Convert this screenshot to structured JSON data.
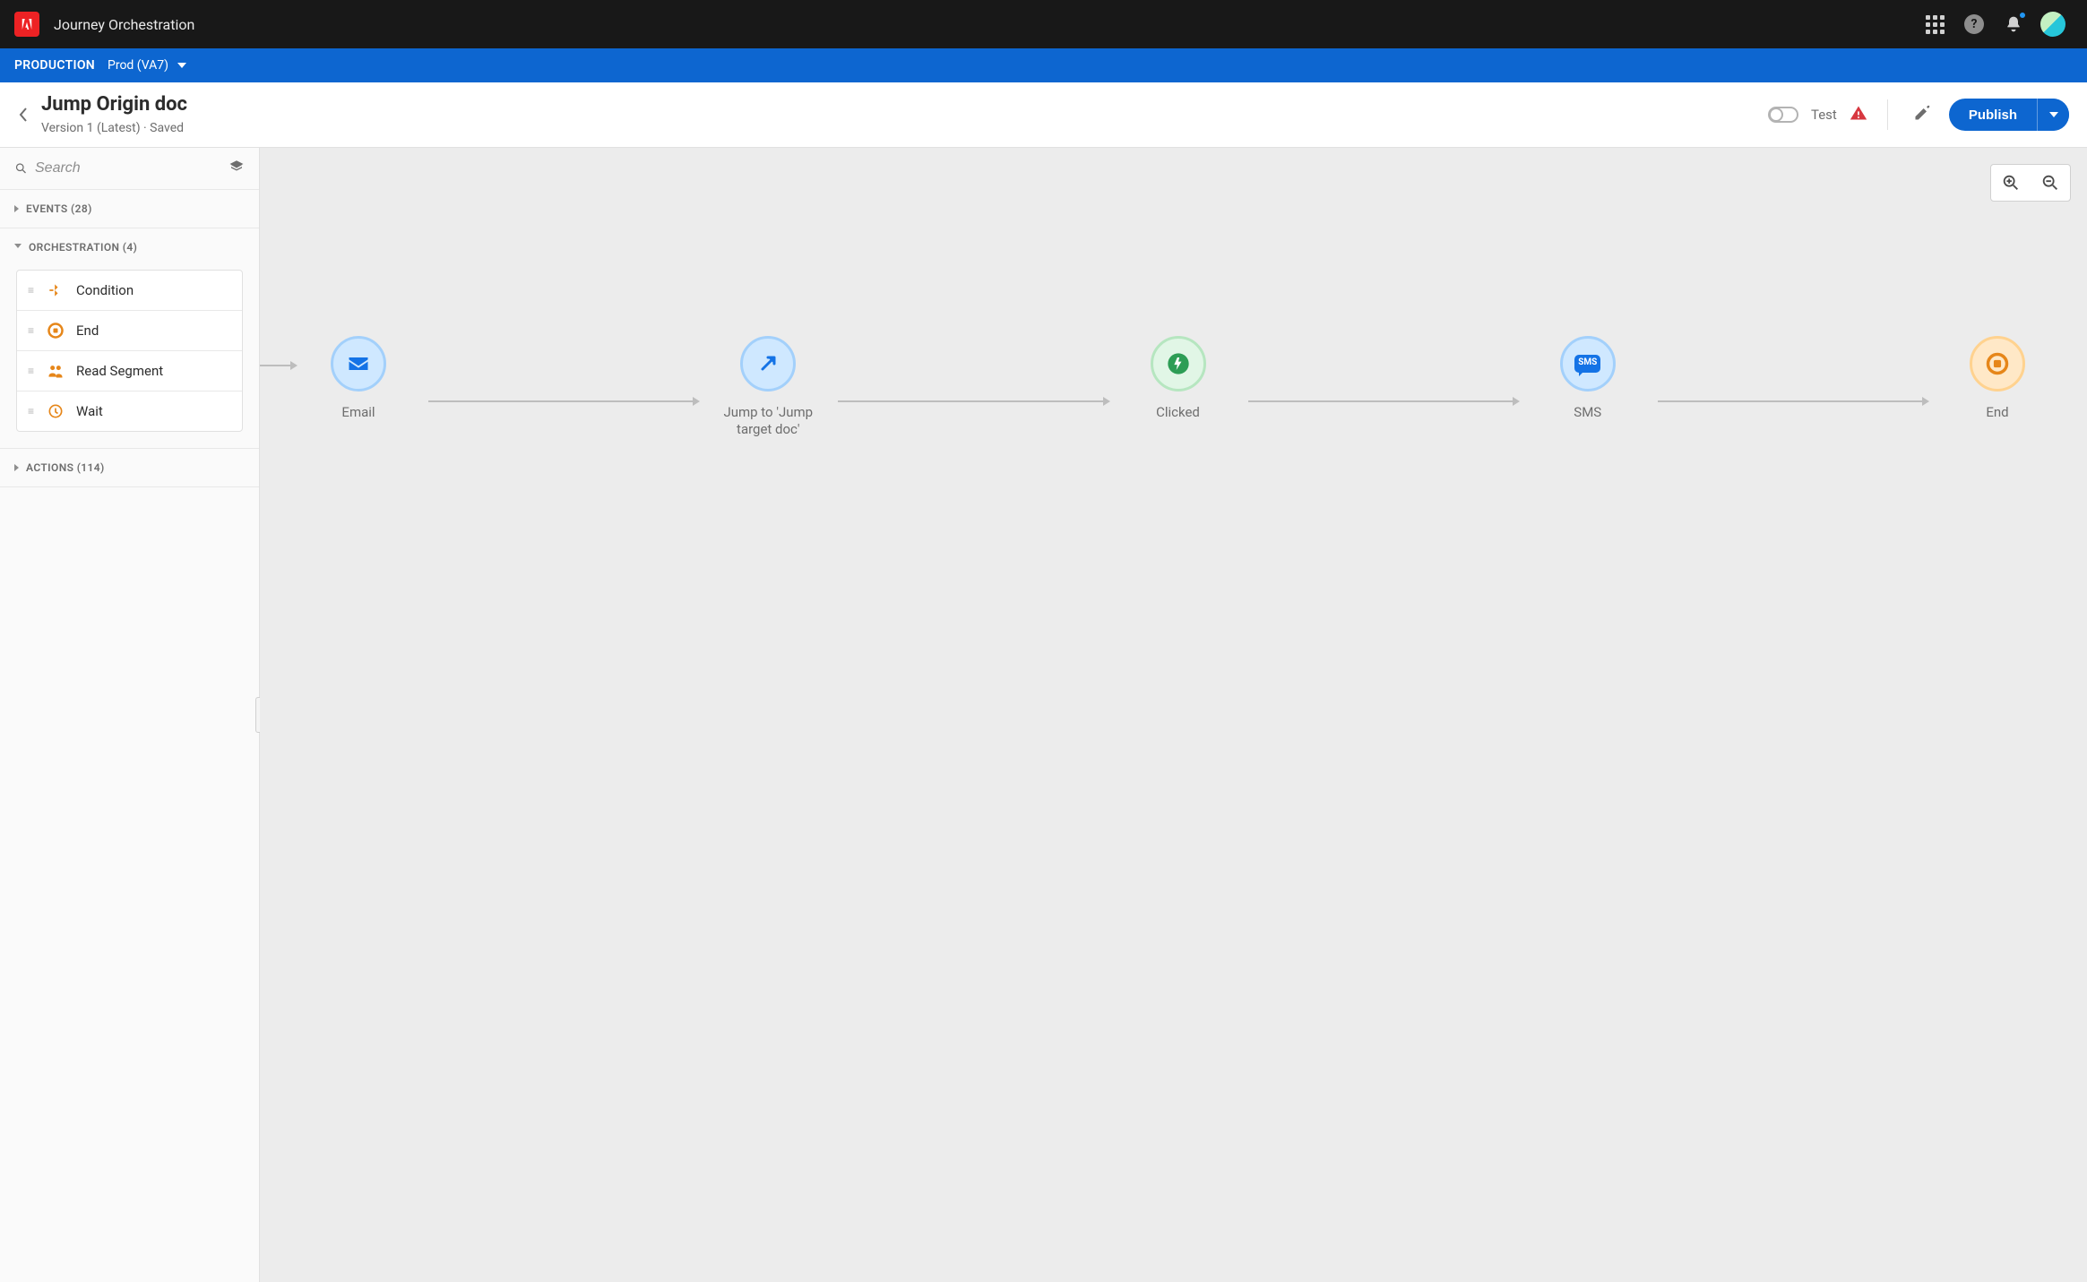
{
  "app": {
    "product": "Journey Orchestration"
  },
  "env": {
    "label": "PRODUCTION",
    "selected": "Prod (VA7)"
  },
  "page": {
    "title": "Jump Origin doc",
    "subtitle": "Version 1 (Latest) · Saved",
    "test_label": "Test",
    "publish_label": "Publish"
  },
  "sidebar": {
    "search_placeholder": "Search",
    "sections": {
      "events": {
        "label": "EVENTS (28)",
        "open": false
      },
      "orchestration": {
        "label": "ORCHESTRATION (4)",
        "open": true
      },
      "actions": {
        "label": "ACTIONS (114)",
        "open": false
      }
    },
    "orchestration_items": [
      {
        "id": "condition",
        "label": "Condition"
      },
      {
        "id": "end",
        "label": "End"
      },
      {
        "id": "read-segment",
        "label": "Read Segment"
      },
      {
        "id": "wait",
        "label": "Wait"
      }
    ]
  },
  "flow": {
    "nodes": [
      {
        "id": "email",
        "label": "Email"
      },
      {
        "id": "jump",
        "label": "Jump to 'Jump target doc'"
      },
      {
        "id": "clicked",
        "label": "Clicked"
      },
      {
        "id": "sms",
        "label": "SMS"
      },
      {
        "id": "end",
        "label": "End"
      }
    ],
    "sms_badge": "SMS"
  }
}
